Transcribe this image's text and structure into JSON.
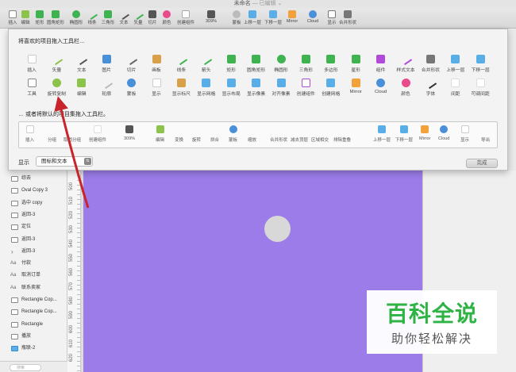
{
  "window": {
    "title": "未命名",
    "subtitle": "— 已编辑 ⌄"
  },
  "toolbar": {
    "items": [
      {
        "label": "插入",
        "icon": "plus-icon",
        "color": "#888888"
      },
      {
        "label": "编辑",
        "icon": "edit-icon",
        "color": "#8cc34a"
      },
      {
        "label": "矩形",
        "icon": "rectangle-icon",
        "color": "#3fb34f"
      },
      {
        "label": "圆角矩形",
        "icon": "rounded-rect-icon",
        "color": "#3fb34f"
      },
      {
        "label": "椭圆形",
        "icon": "oval-icon",
        "color": "#3fb34f"
      },
      {
        "label": "线条",
        "icon": "line-icon",
        "color": "#3fb34f"
      },
      {
        "label": "三角形",
        "icon": "triangle-icon",
        "color": "#3fb34f"
      },
      {
        "label": "文本",
        "icon": "text-icon",
        "color": "#555555"
      },
      {
        "label": "矢量",
        "icon": "vector-icon",
        "color": "#3fb34f"
      },
      {
        "label": "切片",
        "icon": "slice-icon",
        "color": "#555555"
      },
      {
        "label": "颜色",
        "icon": "color-wheel-icon",
        "color": "#e94b8a"
      },
      {
        "label": "创建组件",
        "icon": "create-symbol-icon",
        "color": "#aaaaaa"
      },
      {
        "label": "309%",
        "icon": "zoom-icon",
        "color": "#555555"
      },
      {
        "label": "蒙板",
        "icon": "mask-icon",
        "color": "#bbbbbb"
      },
      {
        "label": "上移一层",
        "icon": "forward-icon",
        "color": "#5aaee8"
      },
      {
        "label": "下移一层",
        "icon": "backward-icon",
        "color": "#5aaee8"
      },
      {
        "label": "Mirror",
        "icon": "mirror-icon",
        "color": "#f2a13b"
      },
      {
        "label": "Cloud",
        "icon": "cloud-icon",
        "color": "#4a90d9"
      },
      {
        "label": "显示",
        "icon": "view-icon",
        "color": "#777777"
      },
      {
        "label": "合并形状",
        "icon": "union-icon",
        "color": "#777777"
      }
    ]
  },
  "sheet": {
    "heading": "将喜欢的项目拖入工具栏…",
    "row1": [
      {
        "label": "插入",
        "icon": "plus-icon",
        "color": "#cccccc"
      },
      {
        "label": "矢量",
        "icon": "pen-icon",
        "color": "#8cc34a"
      },
      {
        "label": "文本",
        "icon": "text-icon",
        "color": "#555555"
      },
      {
        "label": "图片",
        "icon": "image-icon",
        "color": "#4a90d9"
      },
      {
        "label": "切片",
        "icon": "knife-icon",
        "color": "#666666"
      },
      {
        "label": "画板",
        "icon": "artboard-icon",
        "color": "#d9a04a"
      },
      {
        "label": "线条",
        "icon": "line-icon",
        "color": "#3fb34f"
      },
      {
        "label": "箭头",
        "icon": "arrow-icon",
        "color": "#3fb34f"
      },
      {
        "label": "矩形",
        "icon": "rectangle-icon",
        "color": "#3fb34f"
      },
      {
        "label": "圆角矩形",
        "icon": "rounded-rect-icon",
        "color": "#3fb34f"
      },
      {
        "label": "椭圆形",
        "icon": "oval-icon",
        "color": "#3fb34f"
      },
      {
        "label": "三角形",
        "icon": "triangle-icon",
        "color": "#3fb34f"
      },
      {
        "label": "多边形",
        "icon": "polygon-icon",
        "color": "#3fb34f"
      },
      {
        "label": "星形",
        "icon": "star-icon",
        "color": "#3fb34f"
      },
      {
        "label": "组件",
        "icon": "symbol-icon",
        "color": "#b14ad9"
      },
      {
        "label": "样式文本",
        "icon": "text-style-icon",
        "color": "#b14ad9"
      },
      {
        "label": "合并形状",
        "icon": "union-icon",
        "color": "#777777"
      },
      {
        "label": "上移一层",
        "icon": "forward-icon",
        "color": "#5aaee8"
      },
      {
        "label": "下移一层",
        "icon": "backward-icon",
        "color": "#5aaee8"
      }
    ],
    "row2": [
      {
        "label": "工具",
        "icon": "tools-icon",
        "color": "#888888"
      },
      {
        "label": "旋转复制",
        "icon": "rotate-copies-icon",
        "color": "#8cc34a"
      },
      {
        "label": "编辑",
        "icon": "edit-icon",
        "color": "#8cc34a"
      },
      {
        "label": "轮廓",
        "icon": "outline-icon",
        "color": "#bbbbbb"
      },
      {
        "label": "蒙板",
        "icon": "mask-icon",
        "color": "#4a90d9"
      },
      {
        "label": "显示",
        "icon": "view-icon",
        "color": "#cccccc"
      },
      {
        "label": "显示标尺",
        "icon": "ruler-icon",
        "color": "#d9a04a"
      },
      {
        "label": "显示网格",
        "icon": "grid-icon",
        "color": "#5aaee8"
      },
      {
        "label": "显示布局",
        "icon": "layout-icon",
        "color": "#5aaee8"
      },
      {
        "label": "显示像素",
        "icon": "pixel-icon",
        "color": "#5aaee8"
      },
      {
        "label": "对齐像素",
        "icon": "pixel-align-icon",
        "color": "#5aaee8"
      },
      {
        "label": "创建组件",
        "icon": "create-symbol-icon",
        "color": "#b14ad9"
      },
      {
        "label": "创建网格",
        "icon": "make-grid-icon",
        "color": "#5aaee8"
      },
      {
        "label": "Mirror",
        "icon": "mirror-icon",
        "color": "#f2a13b"
      },
      {
        "label": "Cloud",
        "icon": "cloud-icon",
        "color": "#4a90d9"
      },
      {
        "label": "颜色",
        "icon": "color-wheel-icon",
        "color": "#e94b8a"
      },
      {
        "label": "字体",
        "icon": "font-icon",
        "color": "#333333"
      },
      {
        "label": "间距",
        "icon": "space-icon",
        "color": "#dddddd"
      },
      {
        "label": "可调间距",
        "icon": "flexible-space-icon",
        "color": "#dddddd"
      }
    ],
    "default_heading": "… 或者将默认的项目集拖入工具栏。",
    "defaults": [
      {
        "label": "插入",
        "icon": "plus-icon",
        "color": "#cccccc"
      },
      {
        "label": "分组",
        "icon": "",
        "color": ""
      },
      {
        "label": "取消分组",
        "icon": "",
        "color": ""
      },
      {
        "label": "创建组件",
        "icon": "create-symbol-icon",
        "color": "#dddddd"
      },
      {
        "label": "309%",
        "icon": "zoom-icon",
        "color": "#555555"
      },
      {
        "label": "编辑",
        "icon": "edit-icon",
        "color": "#8cc34a"
      },
      {
        "label": "变换",
        "icon": "",
        "color": ""
      },
      {
        "label": "旋转",
        "icon": "",
        "color": ""
      },
      {
        "label": "拼合",
        "icon": "",
        "color": ""
      },
      {
        "label": "蒙板",
        "icon": "mask-icon",
        "color": "#4a90d9"
      },
      {
        "label": "缩放",
        "icon": "",
        "color": ""
      },
      {
        "label": "合并形状",
        "icon": "",
        "color": ""
      },
      {
        "label": "减去顶层",
        "icon": "",
        "color": ""
      },
      {
        "label": "区域相交",
        "icon": "",
        "color": ""
      },
      {
        "label": "排除重叠",
        "icon": "",
        "color": ""
      },
      {
        "label": "上移一层",
        "icon": "forward-icon",
        "color": "#5aaee8"
      },
      {
        "label": "下移一层",
        "icon": "backward-icon",
        "color": "#5aaee8"
      },
      {
        "label": "Mirror",
        "icon": "mirror-icon",
        "color": "#f2a13b"
      },
      {
        "label": "Cloud",
        "icon": "cloud-icon",
        "color": "#4a90d9"
      },
      {
        "label": "显示",
        "icon": "view-icon",
        "color": "#cccccc"
      },
      {
        "label": "导出",
        "icon": "",
        "color": ""
      }
    ],
    "show_label": "显示",
    "show_value": "图标和文本",
    "done_label": "完成"
  },
  "layers": [
    {
      "name": "综去",
      "icon": "shape"
    },
    {
      "name": "Oval Copy 3",
      "icon": "shape"
    },
    {
      "name": "选中 copy",
      "icon": "shape"
    },
    {
      "name": "返回-3",
      "icon": "shape"
    },
    {
      "name": "定位",
      "icon": "shape"
    },
    {
      "name": "返回-3",
      "icon": "shape"
    },
    {
      "name": "返回-3",
      "icon": "chevron"
    },
    {
      "name": "付款",
      "icon": "text"
    },
    {
      "name": "取消订单",
      "icon": "text"
    },
    {
      "name": "联系卖家",
      "icon": "text"
    },
    {
      "name": "Rectangle Cop...",
      "icon": "shape"
    },
    {
      "name": "Rectangle Cop...",
      "icon": "shape"
    },
    {
      "name": "Rectangle",
      "icon": "shape"
    },
    {
      "name": "播放",
      "icon": "shape"
    },
    {
      "name": "瓶联-2",
      "icon": "folder"
    }
  ],
  "layers_search_placeholder": "搜索",
  "ruler": [
    "500",
    "510",
    "520",
    "530",
    "540",
    "550",
    "560",
    "570",
    "580",
    "590",
    "600",
    "610",
    "620"
  ],
  "artboard_color": "#9b7ce8",
  "watermark": {
    "title": "百科全说",
    "subtitle": "助你轻松解决"
  }
}
